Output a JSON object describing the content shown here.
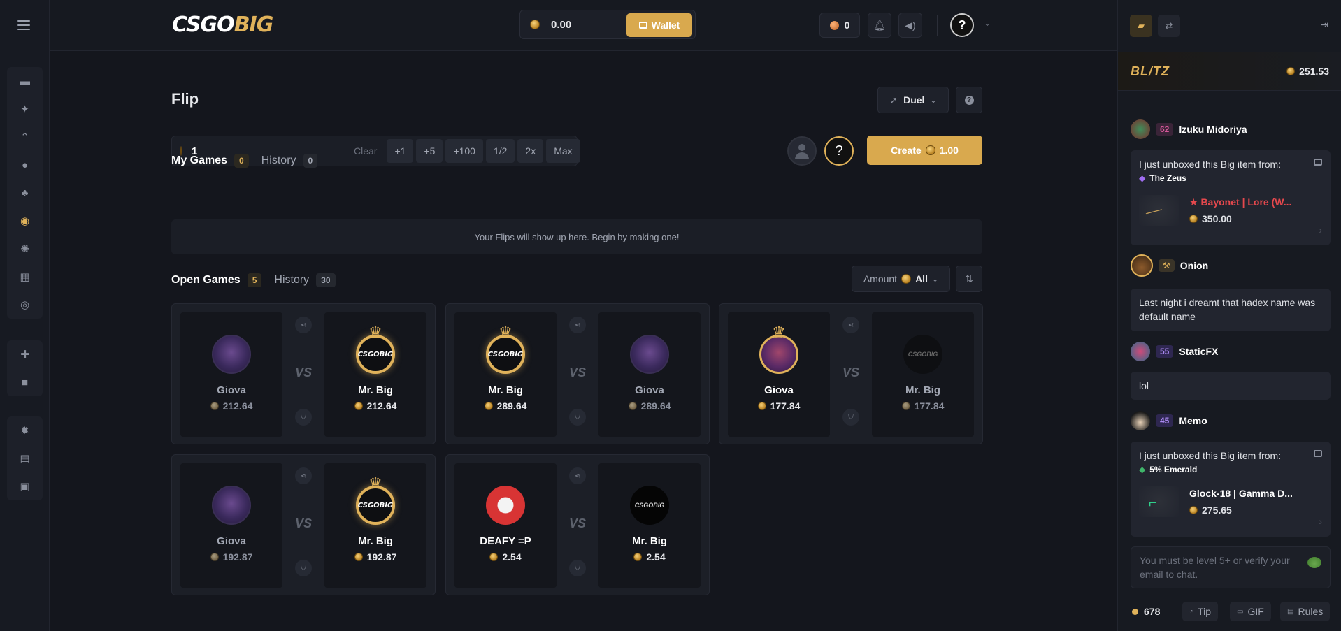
{
  "app": {
    "logo_left": "CSGO",
    "logo_right": "BIG"
  },
  "header": {
    "balance": "0.00",
    "wallet_label": "Wallet",
    "points": "0",
    "help_label": "?"
  },
  "page": {
    "title": "Flip",
    "mode_label": "Duel",
    "bet_value": "1",
    "clear_label": "Clear",
    "bet_buttons": [
      "+1",
      "+5",
      "+100",
      "1/2",
      "2x",
      "Max"
    ],
    "help_label": "?",
    "create_label": "Create",
    "create_amount": "1.00"
  },
  "my_games": {
    "tab_my": "My Games",
    "my_count": "0",
    "tab_history": "History",
    "history_count": "0",
    "empty_message": "Your Flips will show up here. Begin by making one!"
  },
  "open_games": {
    "tab_open": "Open Games",
    "open_count": "5",
    "tab_history": "History",
    "history_count": "30",
    "filter_label": "Amount",
    "filter_value": "All",
    "vs_label": "VS",
    "games": [
      {
        "left": {
          "name": "Giova",
          "amount": "212.64"
        },
        "right": {
          "name": "Mr. Big",
          "amount": "212.64"
        }
      },
      {
        "left": {
          "name": "Mr. Big",
          "amount": "289.64"
        },
        "right": {
          "name": "Giova",
          "amount": "289.64"
        }
      },
      {
        "left": {
          "name": "Giova",
          "amount": "177.84"
        },
        "right": {
          "name": "Mr. Big",
          "amount": "177.84"
        }
      },
      {
        "left": {
          "name": "Giova",
          "amount": "192.87"
        },
        "right": {
          "name": "Mr. Big",
          "amount": "192.87"
        }
      },
      {
        "left": {
          "name": "DEAFY =P",
          "amount": "2.54"
        },
        "right": {
          "name": "Mr. Big",
          "amount": "2.54"
        }
      }
    ]
  },
  "chat": {
    "blitz_logo": "BL/TZ",
    "blitz_amount": "251.53",
    "messages": [
      {
        "level": "62",
        "name": "Izuku Midoriya",
        "intro": "I just unboxed this Big item from:",
        "from": "The Zeus",
        "item": "★ Bayonet | Lore (W...",
        "price": "350.00"
      },
      {
        "level": "",
        "name": "Onion",
        "text": "Last night i dreamt that hadex name was default name"
      },
      {
        "level": "55",
        "name": "StaticFX",
        "text": "lol"
      },
      {
        "level": "45",
        "name": "Memo",
        "intro": "I just unboxed this Big item from:",
        "from": "5% Emerald",
        "item": "Glock-18 | Gamma D...",
        "price": "275.65"
      }
    ],
    "input_placeholder": "You must be level 5+ or verify your email to chat.",
    "online_count": "678",
    "actions": {
      "tip": "Tip",
      "gif": "GIF",
      "rules": "Rules"
    }
  }
}
